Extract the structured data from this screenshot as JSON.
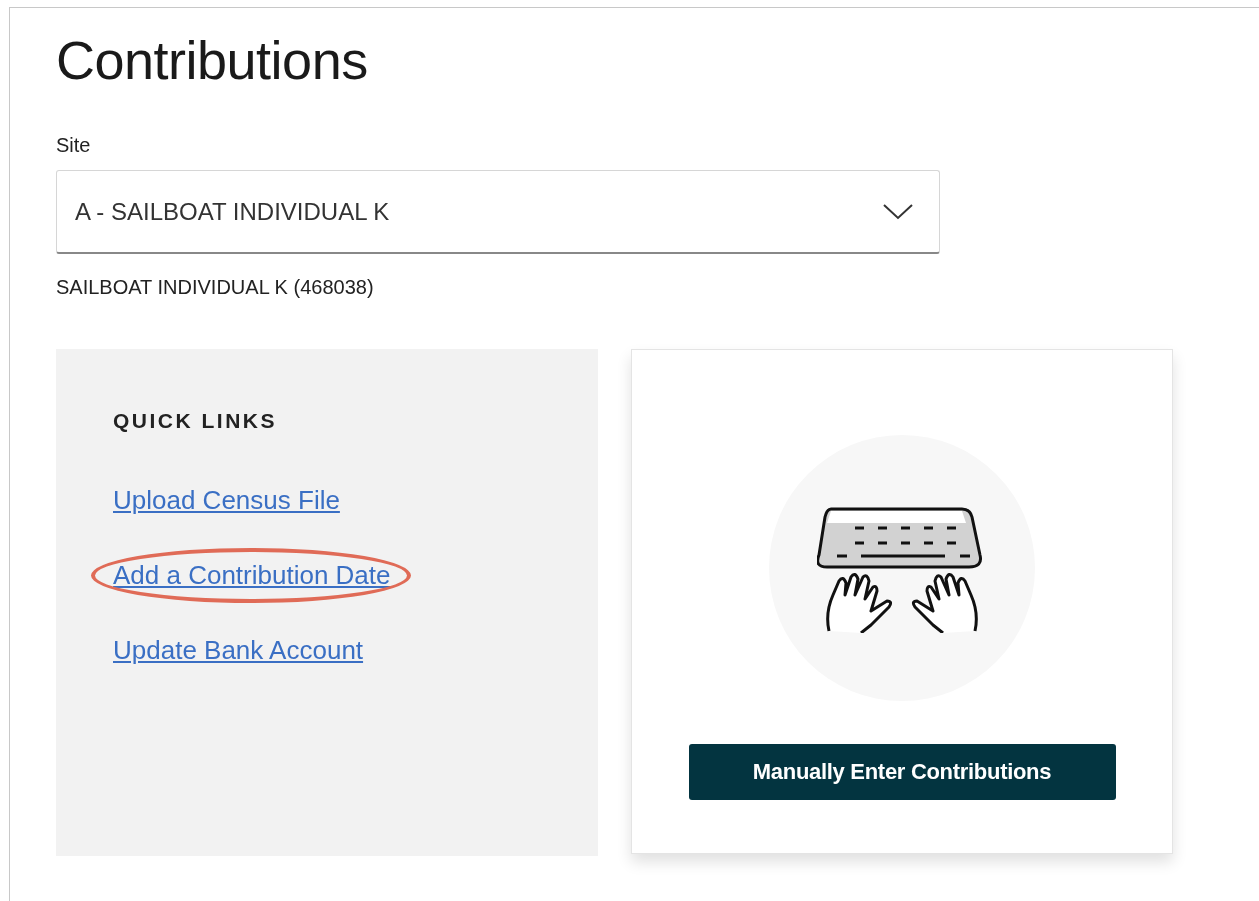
{
  "title": "Contributions",
  "site": {
    "label": "Site",
    "value": "A - SAILBOAT INDIVIDUAL K",
    "caption": "SAILBOAT INDIVIDUAL K (468038)"
  },
  "quick_links": {
    "heading": "QUICK LINKS",
    "links": [
      {
        "label": "Upload Census File",
        "highlighted": false
      },
      {
        "label": "Add a Contribution Date",
        "highlighted": true
      },
      {
        "label": "Update Bank Account",
        "highlighted": false
      }
    ]
  },
  "manual_card": {
    "button": "Manually Enter Contributions"
  }
}
